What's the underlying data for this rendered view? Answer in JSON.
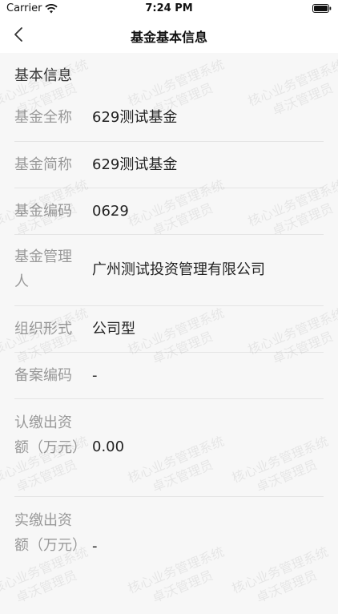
{
  "status_bar": {
    "carrier": "Carrier",
    "time": "7:24 PM"
  },
  "nav": {
    "title": "基金基本信息",
    "back_icon": "chevron-left-icon"
  },
  "section_title": "基本信息",
  "fields": [
    {
      "label": "基金全称",
      "value": "629测试基金"
    },
    {
      "label": "基金简称",
      "value": "629测试基金"
    },
    {
      "label": "基金编码",
      "value": "0629"
    },
    {
      "label": "基金管理人",
      "value": "广州测试投资管理有限公司"
    },
    {
      "label": "组织形式",
      "value": "公司型"
    },
    {
      "label": "备案编码",
      "value": "-"
    },
    {
      "label": "认缴出资额（万元）",
      "value": "0.00"
    },
    {
      "label": "实缴出资额（万元）",
      "value": "-"
    }
  ],
  "watermark": {
    "line1": "核心业务管理系统",
    "line2": "卓沃管理员"
  }
}
